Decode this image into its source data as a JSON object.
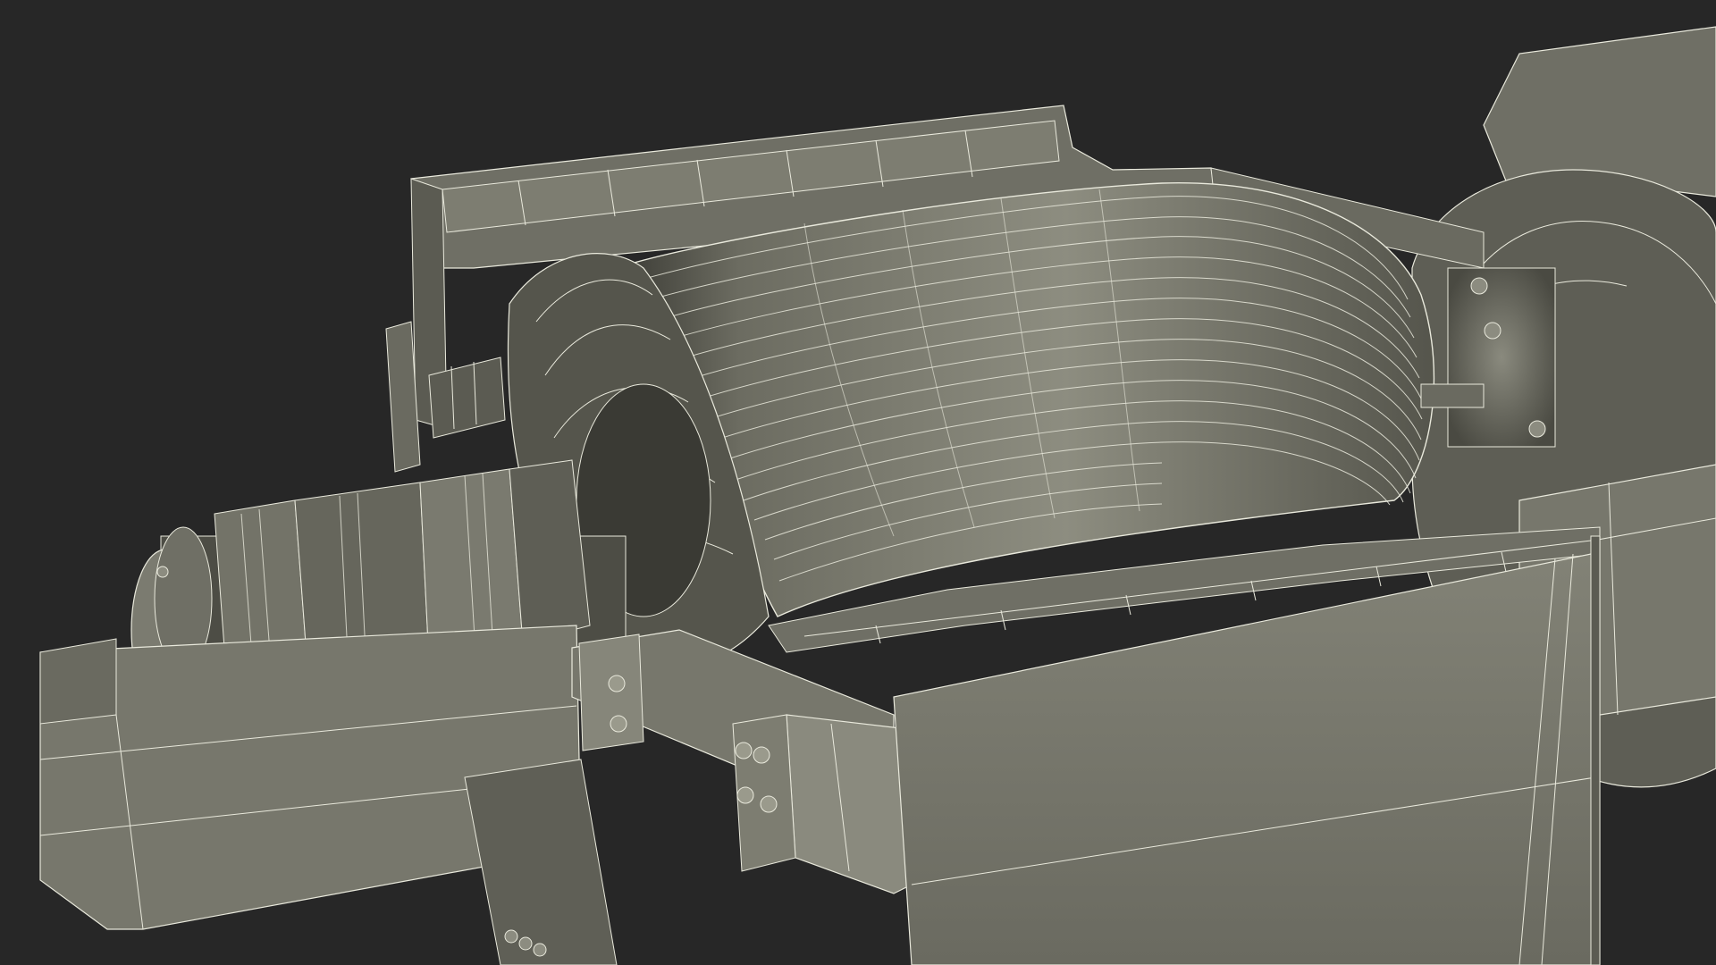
{
  "scene": {
    "subject": "wireframe-rendered-electric-generator",
    "colors": {
      "background": "#272727",
      "surface": "#7e7e72",
      "surface_light": "#9a9a8c",
      "surface_dark": "#55554b",
      "shadow": "#2e2e2a",
      "wire": "#e9e9dc"
    }
  }
}
